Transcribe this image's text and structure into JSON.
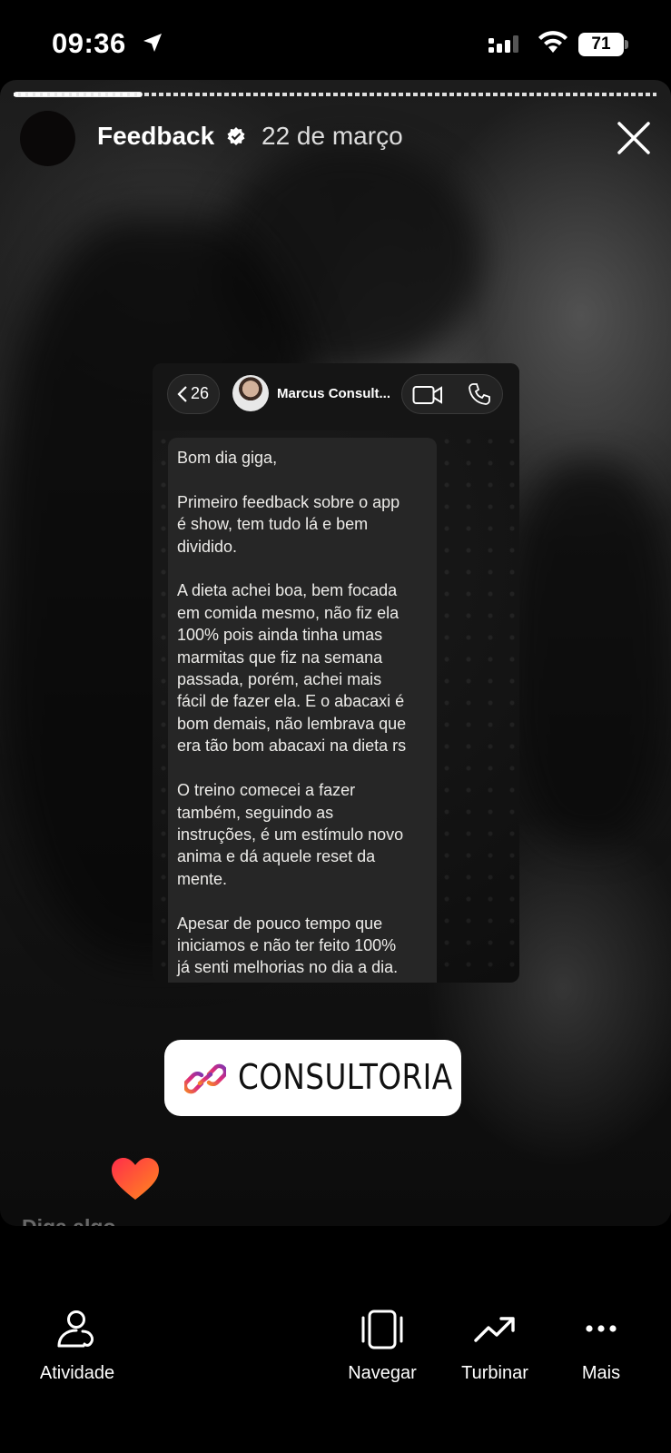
{
  "status_bar": {
    "time": "09:36",
    "battery": "71",
    "icons": [
      "location-arrow-icon",
      "signal-icon",
      "wifi-icon",
      "battery-icon"
    ]
  },
  "story": {
    "account_name": "Feedback",
    "date": "22 de março",
    "verified": true,
    "progress": 0.2
  },
  "chat_screenshot": {
    "unread_count": "26",
    "contact_name": "Marcus Consult...",
    "message": "Bom dia giga,\n\nPrimeiro feedback sobre o app\né show, tem tudo lá e bem\ndividido.\n\nA dieta achei boa, bem focada\nem comida mesmo, não fiz ela\n100% pois ainda tinha umas\nmarmitas que fiz na semana\npassada, porém, achei mais\nfácil de fazer ela. E o abacaxi é\nbom demais, não lembrava que\nera tão bom abacaxi na dieta rs\n\nO treino comecei a fazer\ntambém, seguindo as\ninstruções, é um estímulo novo\nanima e dá aquele reset da\nmente.\n\nApesar de pouco tempo que\niniciamos e não ter feito 100%\njá senti melhorias no dia a dia."
  },
  "link_sticker": {
    "label": "CONSULTORIA",
    "gradient": [
      "#f58529",
      "#dd2a7b",
      "#8134af"
    ]
  },
  "reply": {
    "placeholder": "Diga algo..."
  },
  "bottom_nav": {
    "items": [
      {
        "label": "Atividade",
        "icon": "activity-icon"
      },
      {
        "label": "Navegar",
        "icon": "navigate-icon"
      },
      {
        "label": "Turbinar",
        "icon": "boost-icon"
      },
      {
        "label": "Mais",
        "icon": "more-icon"
      }
    ]
  },
  "colors": {
    "background": "#000000",
    "chat_bubble": "#262626",
    "heart_gradient": [
      "#ff2d4a",
      "#ff8a1e"
    ]
  }
}
